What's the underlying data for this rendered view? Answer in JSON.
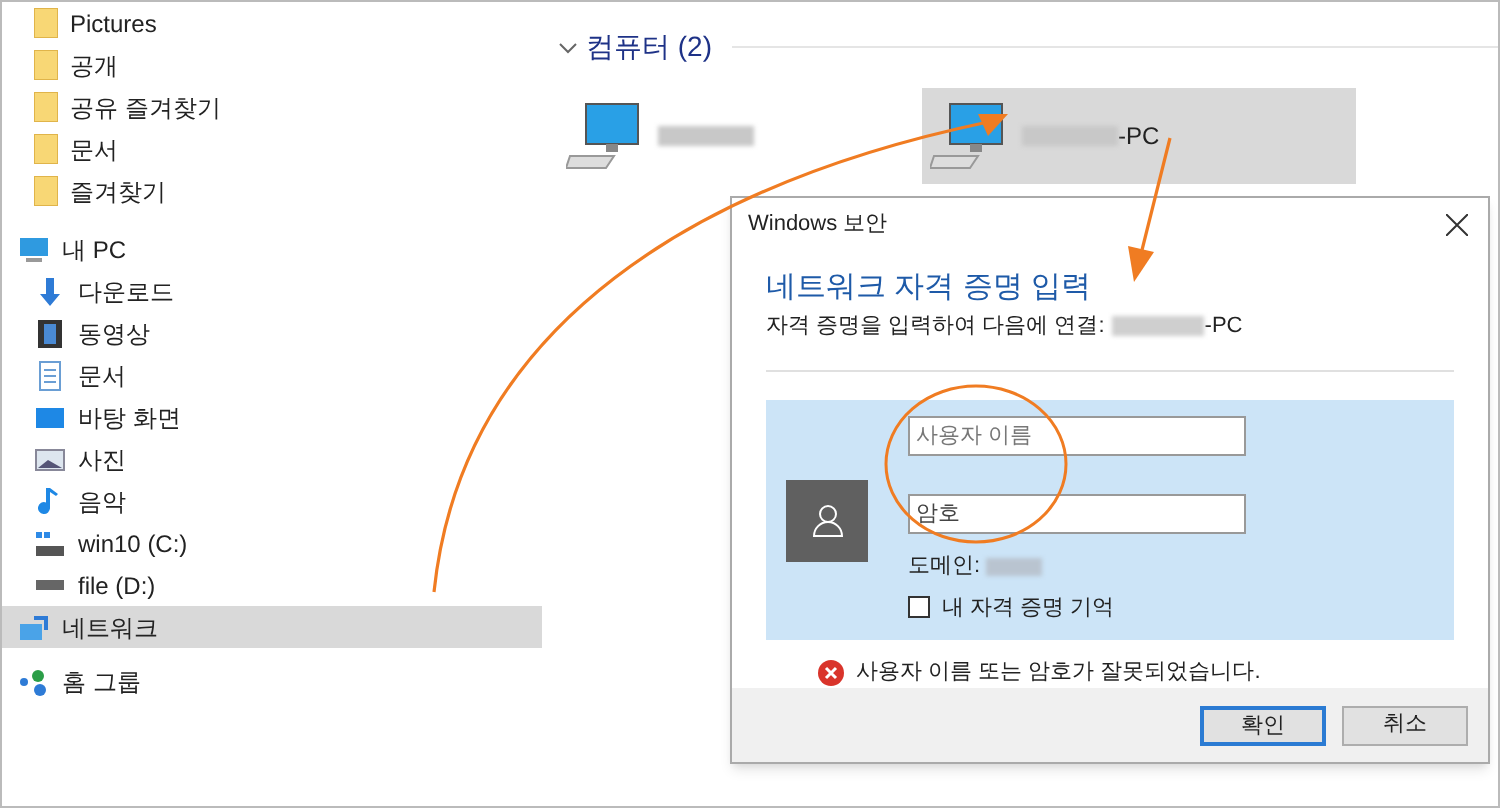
{
  "sidebar": {
    "quick_access_items": [
      {
        "label": "Pictures",
        "selected": false
      },
      {
        "label": "공개",
        "selected": false
      },
      {
        "label": "공유 즐겨찾기",
        "selected": false
      },
      {
        "label": "문서",
        "selected": false
      },
      {
        "label": "즐겨찾기",
        "selected": false
      }
    ],
    "items": [
      {
        "label": "내 PC",
        "kind": "pc",
        "selected": false,
        "children": [
          {
            "label": "다운로드",
            "kind": "download",
            "selected": false
          },
          {
            "label": "동영상",
            "kind": "video",
            "selected": false
          },
          {
            "label": "문서",
            "kind": "document",
            "selected": false
          },
          {
            "label": "바탕 화면",
            "kind": "desktop",
            "selected": false
          },
          {
            "label": "사진",
            "kind": "picture",
            "selected": false
          },
          {
            "label": "음악",
            "kind": "music",
            "selected": false
          },
          {
            "label": "win10 (C:)",
            "kind": "system_drive",
            "selected": false
          },
          {
            "label": "file (D:)",
            "kind": "drive",
            "selected": false
          }
        ]
      },
      {
        "label": "네트워크",
        "kind": "network",
        "selected": true
      },
      {
        "label": "홈 그룹",
        "kind": "homegroup",
        "selected": false
      }
    ]
  },
  "group": {
    "title": "컴퓨터 (2)",
    "expanded": true,
    "computers": [
      {
        "selected": false
      },
      {
        "suffix": "-PC",
        "selected": true
      }
    ]
  },
  "dialog": {
    "title": "Windows 보안",
    "heading": "네트워크 자격 증명 입력",
    "subtitle": "자격 증명을 입력하여 다음에 연결:",
    "subtitle_suffix": "-PC",
    "username": {
      "placeholder": "사용자 이름"
    },
    "password": {
      "placeholder": "암호"
    },
    "domain_label": "도메인:",
    "remember": {
      "label": "내 자격 증명 기억",
      "checked": false
    },
    "error": "사용자 이름 또는 암호가 잘못되었습니다.",
    "buttons": [
      {
        "label": "확인",
        "default": true
      },
      {
        "label": "취소",
        "default": false
      }
    ]
  }
}
